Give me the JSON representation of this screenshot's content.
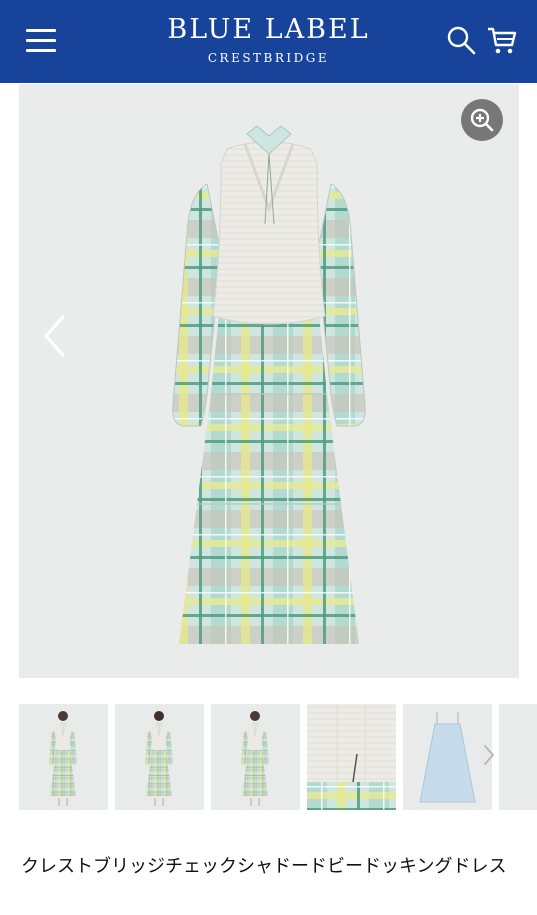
{
  "header": {
    "brand": "BLUE LABEL",
    "sub_brand": "CRESTBRIDGE",
    "background_color": "#17449a",
    "menu_icon": "hamburger-menu-icon",
    "search_icon": "search-icon",
    "cart_icon": "shopping-cart-icon"
  },
  "gallery": {
    "zoom_icon": "zoom-in-icon",
    "prev_icon": "chevron-left-icon",
    "next_icon": "chevron-right-icon",
    "thumbnails": [
      "model-front",
      "model-back",
      "model-front-2",
      "knit-vest-detail",
      "camisole-slip"
    ]
  },
  "product": {
    "title": "クレストブリッジチェックシャドードビードッキングドレス"
  },
  "colors": {
    "check_mint": "#a9d6cc",
    "check_green": "#4f9c82",
    "check_yellow": "#e9ea8e",
    "check_beige": "#cdbfae",
    "knit_ivory": "#ecebe5",
    "slip_blue": "#c6dcec"
  }
}
